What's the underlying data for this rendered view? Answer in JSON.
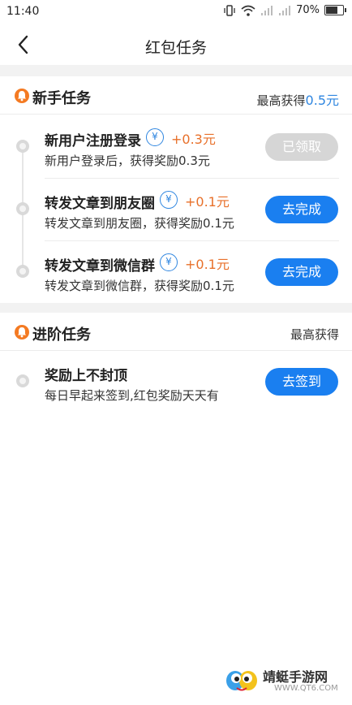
{
  "status_bar": {
    "time": "11:40",
    "battery": "70%"
  },
  "nav": {
    "title": "红包任务"
  },
  "newbie": {
    "title": "新手任务",
    "right_label": "最高获得",
    "right_amount": "0.5元",
    "tasks": [
      {
        "title": "新用户注册登录",
        "reward": "+0.3元",
        "desc": "新用户登录后，获得奖励0.3元",
        "button": "已领取",
        "state": "done"
      },
      {
        "title": "转发文章到朋友圈",
        "reward": "+0.1元",
        "desc": "转发文章到朋友圈，获得奖励0.1元",
        "button": "去完成",
        "state": "todo"
      },
      {
        "title": "转发文章到微信群",
        "reward": "+0.1元",
        "desc": "转发文章到微信群，获得奖励0.1元",
        "button": "去完成",
        "state": "todo"
      }
    ]
  },
  "advanced": {
    "title": "进阶任务",
    "right_label": "最高获得",
    "tasks": [
      {
        "title": "奖励上不封顶",
        "desc": "每日早起来签到,红包奖励天天有",
        "button": "去签到",
        "state": "todo"
      }
    ]
  },
  "coin_symbol": "¥",
  "watermark": {
    "name": "靖蜓手游网",
    "url": "WWW.QT6.COM"
  },
  "colors": {
    "accent": "#1a7ff0",
    "reward": "#e8702a",
    "section_icon": "#f47a22",
    "disabled": "#d6d6d6"
  }
}
